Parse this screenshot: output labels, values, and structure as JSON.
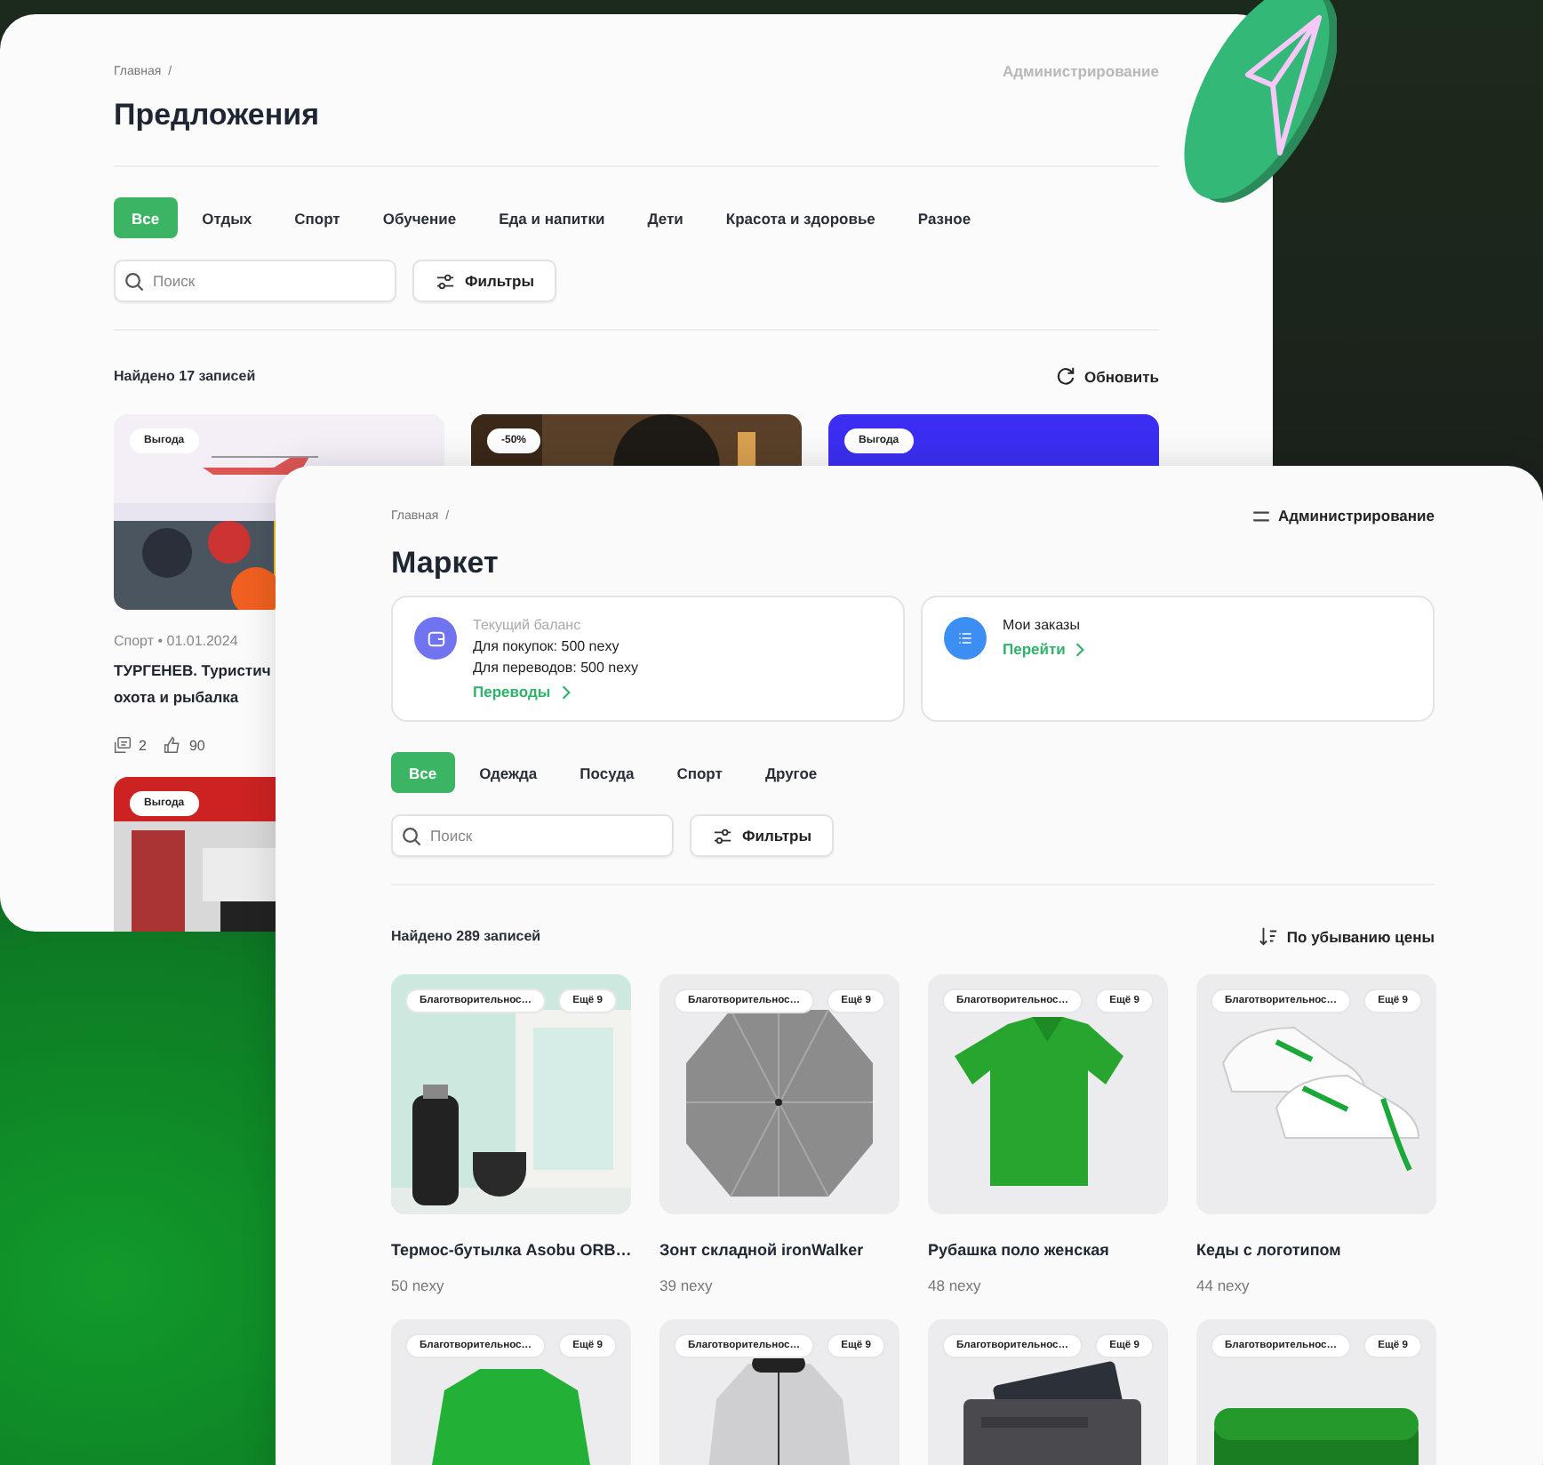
{
  "offers_window": {
    "breadcrumb": "Главная",
    "breadcrumb_separator": "/",
    "admin": "Администрирование",
    "title": "Предложения",
    "tabs": [
      {
        "label": "Все",
        "selected": true
      },
      {
        "label": "Отдых",
        "selected": false
      },
      {
        "label": "Спорт",
        "selected": false
      },
      {
        "label": "Обучение",
        "selected": false
      },
      {
        "label": "Еда и напитки",
        "selected": false
      },
      {
        "label": "Дети",
        "selected": false
      },
      {
        "label": "Красота и здоровье",
        "selected": false
      },
      {
        "label": "Разное",
        "selected": false
      }
    ],
    "search": {
      "placeholder": "Поиск"
    },
    "filters_button": "Фильтры",
    "found": "Найдено 17 записей",
    "refresh_button": "Обновить",
    "cards": [
      {
        "badge": "Выгода",
        "meta": "Спорт • 01.01.2024",
        "title_lines": [
          "ТУРГЕНЕВ. Туристич",
          "охота и рыбалка"
        ],
        "comments": "2",
        "likes": "90"
      },
      {
        "badge": "-50%"
      },
      {
        "badge": "Выгода"
      },
      {
        "badge": "Выгода"
      }
    ]
  },
  "market_window": {
    "breadcrumb": "Главная",
    "breadcrumb_separator": "/",
    "admin_button": "Администрирование",
    "title": "Маркет",
    "balance_card": {
      "label": "Текущий баланс",
      "lines": [
        "Для покупок: 500 nexy",
        "Для переводов: 500 nexy"
      ],
      "link": "Переводы"
    },
    "orders_card": {
      "title": "Мои заказы",
      "link": "Перейти"
    },
    "tabs": [
      {
        "label": "Все",
        "selected": true
      },
      {
        "label": "Одежда",
        "selected": false
      },
      {
        "label": "Посуда",
        "selected": false
      },
      {
        "label": "Спорт",
        "selected": false
      },
      {
        "label": "Другое",
        "selected": false
      }
    ],
    "search": {
      "placeholder": "Поиск"
    },
    "filters_button": "Фильтры",
    "found": "Найдено 289 записей",
    "sort_button": "По убыванию цены",
    "products": [
      {
        "tag": "Благотворительнос…",
        "more": "Ещё 9",
        "title": "Термос-бутылка Asobu ORB…",
        "price": "50 nexy"
      },
      {
        "tag": "Благотворительнос…",
        "more": "Ещё 9",
        "title": "Зонт складной ironWalker",
        "price": "39 nexy"
      },
      {
        "tag": "Благотворительнос…",
        "more": "Ещё 9",
        "title": "Рубашка поло женская",
        "price": "48 nexy"
      },
      {
        "tag": "Благотворительнос…",
        "more": "Ещё 9",
        "title": "Кеды с логотипом",
        "price": "44 nexy"
      },
      {
        "tag": "Благотворительнос…",
        "more": "Ещё 9"
      },
      {
        "tag": "Благотворительнос…",
        "more": "Ещё 9"
      },
      {
        "tag": "Благотворительнос…",
        "more": "Ещё 9"
      },
      {
        "tag": "Благотворительнос…",
        "more": "Ещё 9"
      }
    ]
  }
}
